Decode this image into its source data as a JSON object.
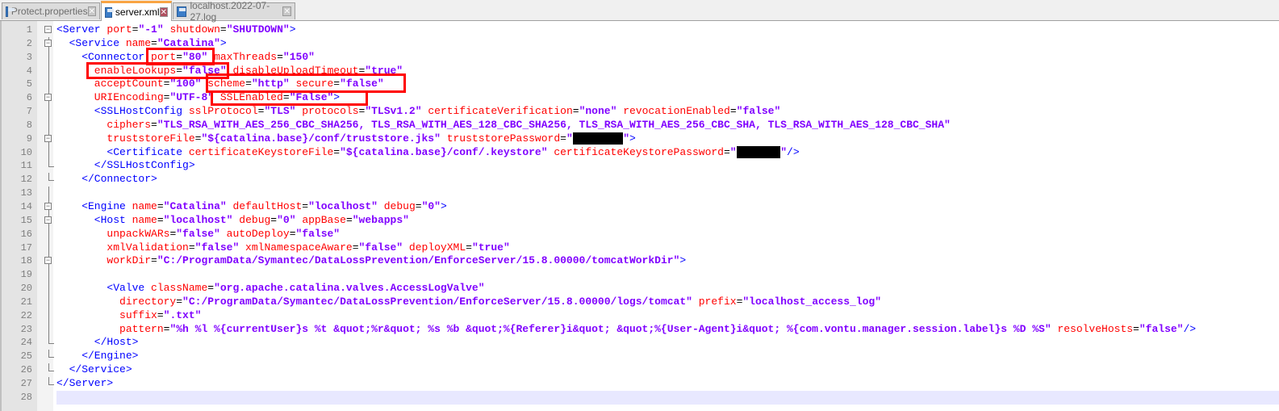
{
  "tabs": [
    {
      "label": "Protect.properties",
      "active": false
    },
    {
      "label": "server.xml",
      "active": true
    },
    {
      "label": "localhost.2022-07-27.log",
      "active": false
    }
  ],
  "close_glyph": "✕",
  "lines": [
    {
      "n": "1",
      "fold": "open",
      "tokens": [
        [
          "t",
          "<Server "
        ],
        [
          "a",
          "port"
        ],
        [
          "p",
          "="
        ],
        [
          "v",
          "\"-1\""
        ],
        [
          "a",
          " shutdown"
        ],
        [
          "p",
          "="
        ],
        [
          "v",
          "\"SHUTDOWN\""
        ],
        [
          "t",
          ">"
        ]
      ]
    },
    {
      "n": "2",
      "fold": "open",
      "tokens": [
        [
          "t",
          "  <Service "
        ],
        [
          "a",
          "name"
        ],
        [
          "p",
          "="
        ],
        [
          "v",
          "\"Catalina\""
        ],
        [
          "t",
          ">"
        ]
      ]
    },
    {
      "n": "3",
      "fold": "line",
      "tokens": [
        [
          "t",
          "    <Connector "
        ],
        [
          "a",
          "port"
        ],
        [
          "p",
          "="
        ],
        [
          "v",
          "\"80\""
        ],
        [
          "a",
          " maxThreads"
        ],
        [
          "p",
          "="
        ],
        [
          "v",
          "\"150\""
        ]
      ]
    },
    {
      "n": "4",
      "fold": "line",
      "tokens": [
        [
          "a",
          "      enableLookups"
        ],
        [
          "p",
          "="
        ],
        [
          "v",
          "\"false\""
        ],
        [
          "a",
          " disableUploadTimeout"
        ],
        [
          "p",
          "="
        ],
        [
          "v",
          "\"true\""
        ]
      ]
    },
    {
      "n": "5",
      "fold": "line",
      "tokens": [
        [
          "a",
          "      acceptCount"
        ],
        [
          "p",
          "="
        ],
        [
          "v",
          "\"100\""
        ],
        [
          "a",
          " scheme"
        ],
        [
          "p",
          "="
        ],
        [
          "v",
          "\"http\""
        ],
        [
          "a",
          " secure"
        ],
        [
          "p",
          "="
        ],
        [
          "v",
          "\"false\""
        ]
      ]
    },
    {
      "n": "6",
      "fold": "open",
      "tokens": [
        [
          "a",
          "      URIEncoding"
        ],
        [
          "p",
          "="
        ],
        [
          "v",
          "\"UTF-8\""
        ],
        [
          "a",
          " SSLEnabled"
        ],
        [
          "p",
          "="
        ],
        [
          "v",
          "\"False\""
        ],
        [
          "t",
          ">"
        ]
      ]
    },
    {
      "n": "7",
      "fold": "line",
      "tokens": [
        [
          "t",
          "      <SSLHostConfig "
        ],
        [
          "a",
          "sslProtocol"
        ],
        [
          "p",
          "="
        ],
        [
          "v",
          "\"TLS\""
        ],
        [
          "a",
          " protocols"
        ],
        [
          "p",
          "="
        ],
        [
          "v",
          "\"TLSv1.2\""
        ],
        [
          "a",
          " certificateVerification"
        ],
        [
          "p",
          "="
        ],
        [
          "v",
          "\"none\""
        ],
        [
          "a",
          " revocationEnabled"
        ],
        [
          "p",
          "="
        ],
        [
          "v",
          "\"false\""
        ]
      ]
    },
    {
      "n": "8",
      "fold": "line",
      "tokens": [
        [
          "a",
          "        ciphers"
        ],
        [
          "p",
          "="
        ],
        [
          "v",
          "\"TLS_RSA_WITH_AES_256_CBC_SHA256, TLS_RSA_WITH_AES_128_CBC_SHA256, TLS_RSA_WITH_AES_256_CBC_SHA, TLS_RSA_WITH_AES_128_CBC_SHA\""
        ]
      ]
    },
    {
      "n": "9",
      "fold": "open",
      "tokens": [
        [
          "a",
          "        truststoreFile"
        ],
        [
          "p",
          "="
        ],
        [
          "v",
          "\"${catalina.base}/conf/truststore.jks\""
        ],
        [
          "a",
          " truststorePassword"
        ],
        [
          "p",
          "="
        ],
        [
          "v",
          "\""
        ],
        [
          "r",
          "        "
        ],
        [
          "v",
          "\""
        ],
        [
          "t",
          ">"
        ]
      ]
    },
    {
      "n": "10",
      "fold": "line",
      "tokens": [
        [
          "t",
          "        <Certificate "
        ],
        [
          "a",
          "certificateKeystoreFile"
        ],
        [
          "p",
          "="
        ],
        [
          "v",
          "\"${catalina.base}/conf/.keystore\""
        ],
        [
          "a",
          " certificateKeystorePassword"
        ],
        [
          "p",
          "="
        ],
        [
          "v",
          "\""
        ],
        [
          "r",
          "       "
        ],
        [
          "v",
          "\""
        ],
        [
          "t",
          "/>"
        ]
      ]
    },
    {
      "n": "11",
      "fold": "end",
      "tokens": [
        [
          "t",
          "      </SSLHostConfig>"
        ]
      ]
    },
    {
      "n": "12",
      "fold": "end",
      "tokens": [
        [
          "t",
          "    </Connector>"
        ]
      ]
    },
    {
      "n": "13",
      "fold": "line",
      "tokens": []
    },
    {
      "n": "14",
      "fold": "open",
      "tokens": [
        [
          "t",
          "    <Engine "
        ],
        [
          "a",
          "name"
        ],
        [
          "p",
          "="
        ],
        [
          "v",
          "\"Catalina\""
        ],
        [
          "a",
          " defaultHost"
        ],
        [
          "p",
          "="
        ],
        [
          "v",
          "\"localhost\""
        ],
        [
          "a",
          " debug"
        ],
        [
          "p",
          "="
        ],
        [
          "v",
          "\"0\""
        ],
        [
          "t",
          ">"
        ]
      ]
    },
    {
      "n": "15",
      "fold": "open",
      "tokens": [
        [
          "t",
          "      <Host "
        ],
        [
          "a",
          "name"
        ],
        [
          "p",
          "="
        ],
        [
          "v",
          "\"localhost\""
        ],
        [
          "a",
          " debug"
        ],
        [
          "p",
          "="
        ],
        [
          "v",
          "\"0\""
        ],
        [
          "a",
          " appBase"
        ],
        [
          "p",
          "="
        ],
        [
          "v",
          "\"webapps\""
        ]
      ]
    },
    {
      "n": "16",
      "fold": "line",
      "tokens": [
        [
          "a",
          "        unpackWARs"
        ],
        [
          "p",
          "="
        ],
        [
          "v",
          "\"false\""
        ],
        [
          "a",
          " autoDeploy"
        ],
        [
          "p",
          "="
        ],
        [
          "v",
          "\"false\""
        ]
      ]
    },
    {
      "n": "17",
      "fold": "line",
      "tokens": [
        [
          "a",
          "        xmlValidation"
        ],
        [
          "p",
          "="
        ],
        [
          "v",
          "\"false\""
        ],
        [
          "a",
          " xmlNamespaceAware"
        ],
        [
          "p",
          "="
        ],
        [
          "v",
          "\"false\""
        ],
        [
          "a",
          " deployXML"
        ],
        [
          "p",
          "="
        ],
        [
          "v",
          "\"true\""
        ]
      ]
    },
    {
      "n": "18",
      "fold": "open",
      "tokens": [
        [
          "a",
          "        workDir"
        ],
        [
          "p",
          "="
        ],
        [
          "v",
          "\"C:/ProgramData/Symantec/DataLossPrevention/EnforceServer/15.8.00000/tomcatWorkDir\""
        ],
        [
          "t",
          ">"
        ]
      ]
    },
    {
      "n": "19",
      "fold": "line",
      "tokens": []
    },
    {
      "n": "20",
      "fold": "line",
      "tokens": [
        [
          "t",
          "        <Valve "
        ],
        [
          "a",
          "className"
        ],
        [
          "p",
          "="
        ],
        [
          "v",
          "\"org.apache.catalina.valves.AccessLogValve\""
        ]
      ]
    },
    {
      "n": "21",
      "fold": "line",
      "tokens": [
        [
          "a",
          "          directory"
        ],
        [
          "p",
          "="
        ],
        [
          "v",
          "\"C:/ProgramData/Symantec/DataLossPrevention/EnforceServer/15.8.00000/logs/tomcat\""
        ],
        [
          "a",
          " prefix"
        ],
        [
          "p",
          "="
        ],
        [
          "v",
          "\"localhost_access_log\""
        ]
      ]
    },
    {
      "n": "22",
      "fold": "line",
      "tokens": [
        [
          "a",
          "          suffix"
        ],
        [
          "p",
          "="
        ],
        [
          "v",
          "\".txt\""
        ]
      ]
    },
    {
      "n": "23",
      "fold": "line",
      "tokens": [
        [
          "a",
          "          pattern"
        ],
        [
          "p",
          "="
        ],
        [
          "v",
          "\"%h %l %{currentUser}s %t &quot;%r&quot; %s %b &quot;%{Referer}i&quot; &quot;%{User-Agent}i&quot; %{com.vontu.manager.session.label}s %D %S\""
        ],
        [
          "a",
          " resolveHosts"
        ],
        [
          "p",
          "="
        ],
        [
          "v",
          "\"false\""
        ],
        [
          "t",
          "/>"
        ]
      ]
    },
    {
      "n": "24",
      "fold": "end",
      "tokens": [
        [
          "t",
          "      </Host>"
        ]
      ]
    },
    {
      "n": "25",
      "fold": "end",
      "tokens": [
        [
          "t",
          "    </Engine>"
        ]
      ]
    },
    {
      "n": "26",
      "fold": "end",
      "tokens": [
        [
          "t",
          "  </Service>"
        ]
      ]
    },
    {
      "n": "27",
      "fold": "end",
      "tokens": [
        [
          "t",
          "</Server>"
        ]
      ]
    },
    {
      "n": "28",
      "fold": "none",
      "current": true,
      "tokens": []
    }
  ]
}
